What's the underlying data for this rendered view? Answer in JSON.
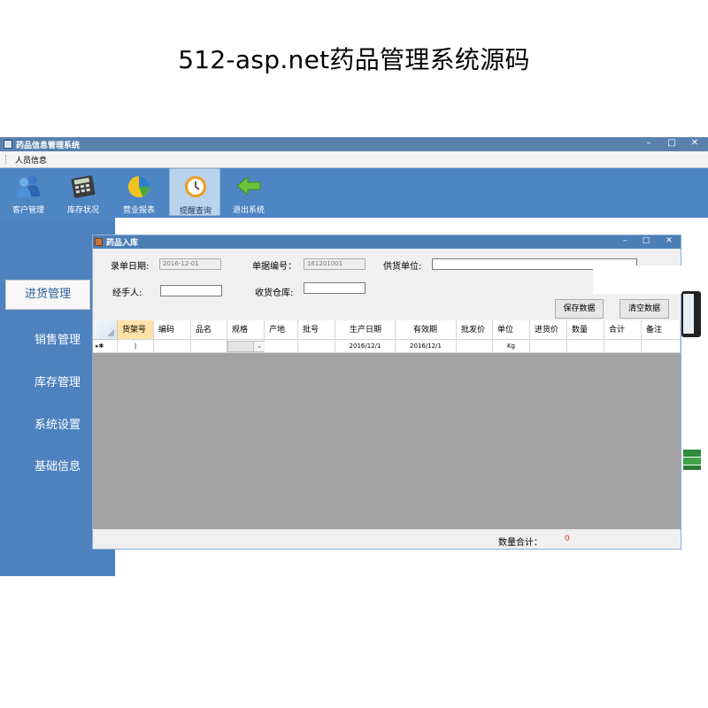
{
  "banner": {
    "title": "512-asp.net药品管理系统源码"
  },
  "window": {
    "title": "药品信息管理系统",
    "menu": [
      "人员信息"
    ]
  },
  "toolbar": [
    {
      "label": "客户管理",
      "icon": "users-icon"
    },
    {
      "label": "库存状况",
      "icon": "calculator-icon"
    },
    {
      "label": "营业报表",
      "icon": "pie-chart-icon"
    },
    {
      "label": "提醒查询",
      "icon": "clock-icon",
      "active": true
    },
    {
      "label": "退出系统",
      "icon": "exit-arrow-icon"
    }
  ],
  "sidebar": [
    {
      "label": "进货管理",
      "active": true
    },
    {
      "label": "销售管理"
    },
    {
      "label": "库存管理"
    },
    {
      "label": "系统设置"
    },
    {
      "label": "基础信息"
    }
  ],
  "dialog": {
    "title": "药品入库",
    "form": {
      "date_label": "录单日期:",
      "date_value": "2016-12-01",
      "order_no_label": "单据编号：",
      "order_no_value": "161201001",
      "supplier_label": "供货单位:",
      "supplier_value": "",
      "handler_label": "经手人:",
      "handler_value": "",
      "warehouse_label": "收货仓库:",
      "warehouse_value": ""
    },
    "buttons": {
      "save": "保存数据",
      "clear": "清空数据"
    },
    "grid": {
      "columns": [
        "货架号",
        "编码",
        "品名",
        "规格",
        "产地",
        "批号",
        "生产日期",
        "有效期",
        "批发价",
        "单位",
        "进货价",
        "数量",
        "合计",
        "备注"
      ],
      "rows": [
        {
          "marker": "▸✱",
          "cells": [
            "|",
            "",
            "",
            "",
            "",
            "",
            "2016/12/1",
            "2016/12/1",
            "",
            "Kg",
            "",
            "",
            "",
            ""
          ]
        }
      ]
    },
    "footer": {
      "total_label": "数量合计：",
      "total_value": "0"
    }
  },
  "colors": {
    "app_blue": "#4f7fb6",
    "sidebar_blue": "#4d82bf",
    "grid_gray": "#a3a3a3",
    "total_red": "#e03030"
  }
}
